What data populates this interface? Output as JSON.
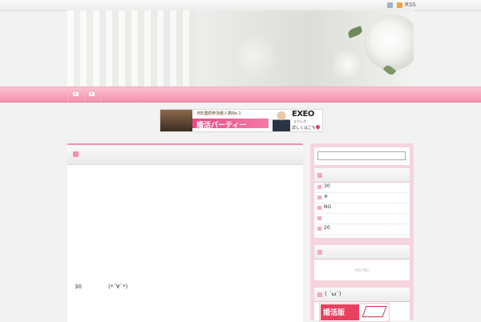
{
  "topbar": {
    "rss_label": "RSS"
  },
  "banner": {
    "top_text": "8年連続参加者人数No.1",
    "main_text": "婚活パーティー",
    "brand": "EXEO",
    "brand_sub": "エクシオ",
    "detail_text": "詳しくはこちら"
  },
  "main": {
    "line_num": "30",
    "line_face": "(*´∀`*)"
  },
  "sidebar": {
    "widget1": {
      "items": [
        "30",
        "※",
        "NG",
        "",
        "20"
      ]
    },
    "widget2": {
      "text": "NG NG"
    },
    "widget3": {
      "title": "( ´ω`)",
      "banner_text": "婚活版"
    }
  },
  "colors": {
    "accent": "#f391ad",
    "nav_bottom": "#e77f9c",
    "sidebar_bg": "#f5d4dd"
  }
}
